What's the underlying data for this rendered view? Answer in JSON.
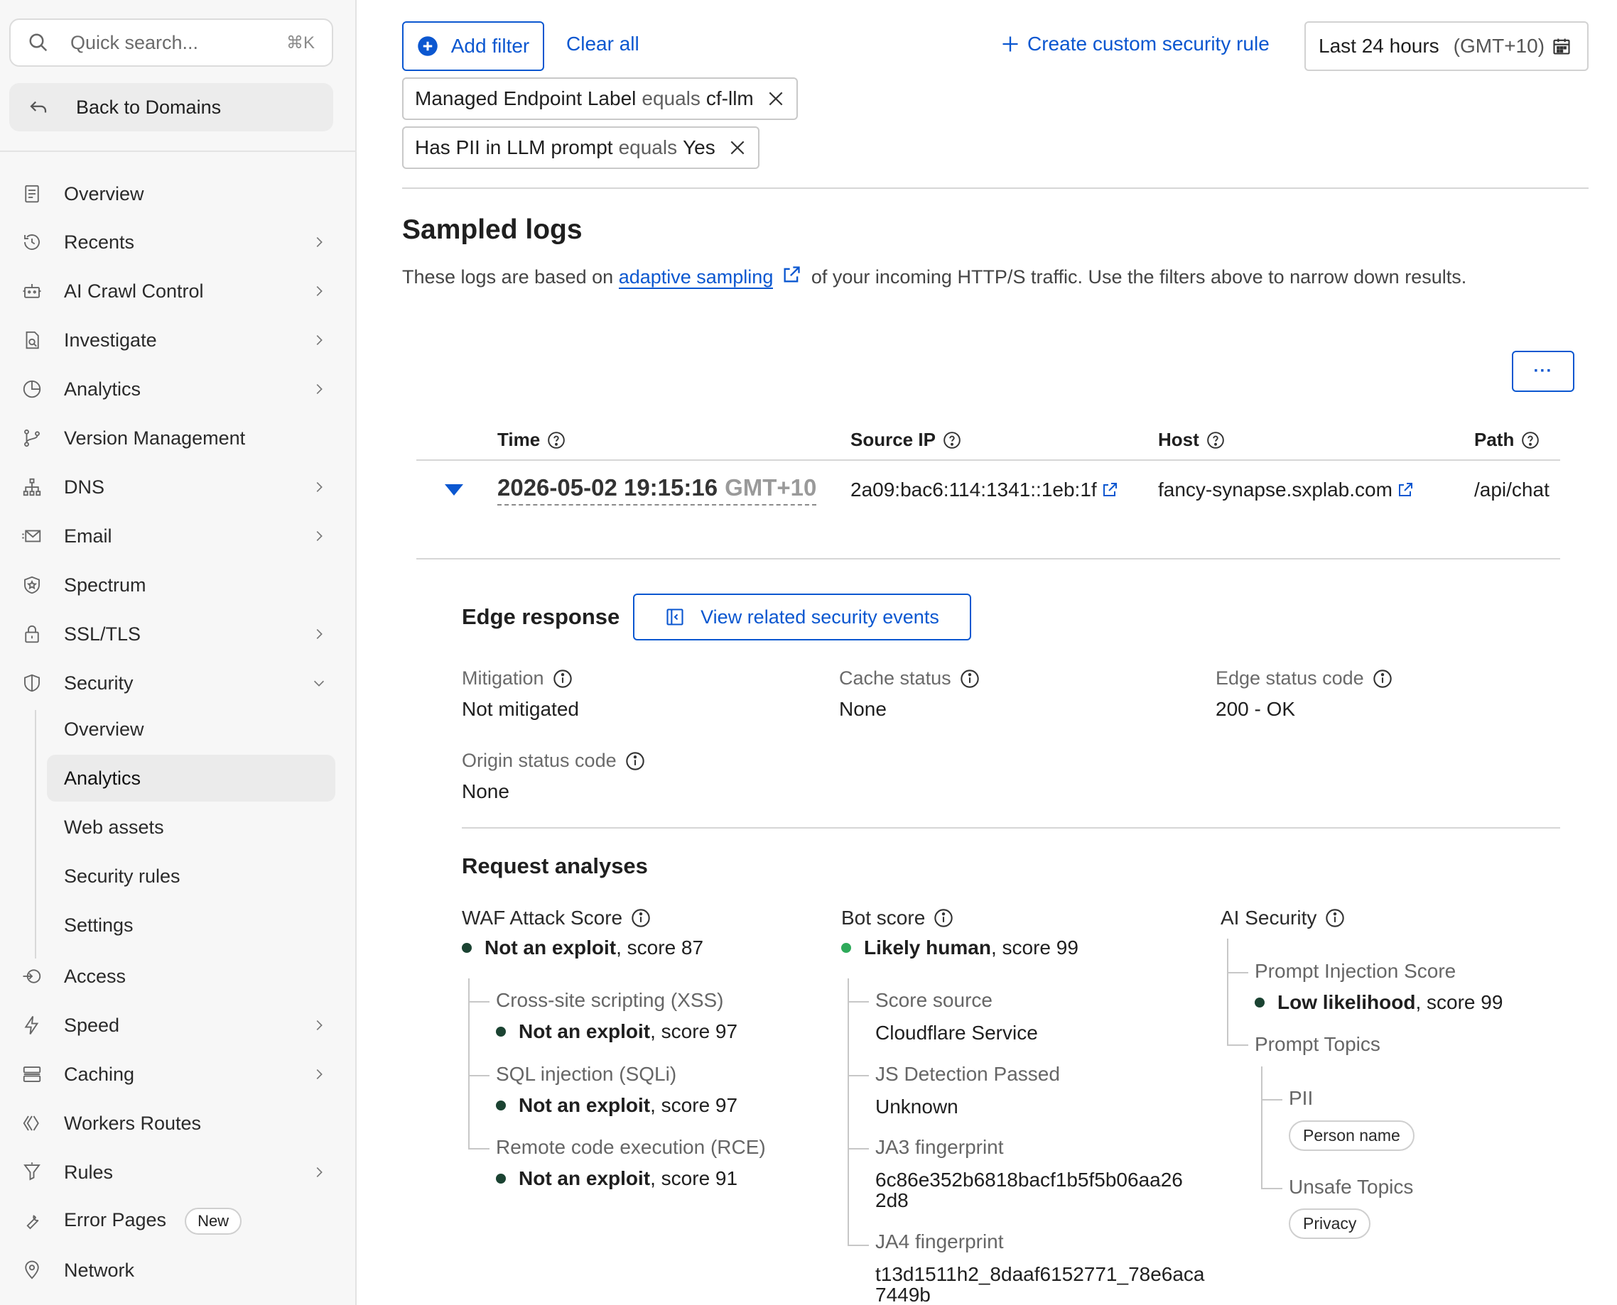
{
  "sidebar": {
    "search_placeholder": "Quick search...",
    "search_shortcut": "⌘K",
    "back_label": "Back to Domains",
    "items": [
      {
        "label": "Overview",
        "icon": "document-icon",
        "chevron": false
      },
      {
        "label": "Recents",
        "icon": "history-icon",
        "chevron": true
      },
      {
        "label": "AI Crawl Control",
        "icon": "robot-icon",
        "chevron": true
      },
      {
        "label": "Investigate",
        "icon": "investigate-icon",
        "chevron": true
      },
      {
        "label": "Analytics",
        "icon": "pie-chart-icon",
        "chevron": true
      },
      {
        "label": "Version Management",
        "icon": "branch-icon",
        "chevron": false
      },
      {
        "label": "DNS",
        "icon": "network-tree-icon",
        "chevron": true
      },
      {
        "label": "Email",
        "icon": "envelope-icon",
        "chevron": true
      },
      {
        "label": "Spectrum",
        "icon": "shield-star-icon",
        "chevron": false
      },
      {
        "label": "SSL/TLS",
        "icon": "lock-icon",
        "chevron": true
      },
      {
        "label": "Security",
        "icon": "shield-icon",
        "chevron": true,
        "expanded": true
      }
    ],
    "security_sub": [
      {
        "label": "Overview",
        "active": false
      },
      {
        "label": "Analytics",
        "active": true
      },
      {
        "label": "Web assets",
        "active": false
      },
      {
        "label": "Security rules",
        "active": false
      },
      {
        "label": "Settings",
        "active": false
      }
    ],
    "items_after": [
      {
        "label": "Access",
        "icon": "access-icon",
        "chevron": false
      },
      {
        "label": "Speed",
        "icon": "lightning-icon",
        "chevron": true
      },
      {
        "label": "Caching",
        "icon": "storage-icon",
        "chevron": true
      },
      {
        "label": "Workers Routes",
        "icon": "workers-icon",
        "chevron": false
      },
      {
        "label": "Rules",
        "icon": "funnel-icon",
        "chevron": true
      },
      {
        "label": "Error Pages",
        "icon": "wrench-icon",
        "chevron": false,
        "badge": "New"
      },
      {
        "label": "Network",
        "icon": "location-pin-icon",
        "chevron": false
      }
    ]
  },
  "filters": {
    "add_filter": "Add filter",
    "clear_all": "Clear all",
    "create_rule": "Create custom security rule",
    "time_range": "Last 24 hours",
    "timezone": "(GMT+10)",
    "chips": [
      {
        "field": "Managed Endpoint Label",
        "op": "equals",
        "value": "cf-llm"
      },
      {
        "field": "Has PII in LLM prompt",
        "op": "equals",
        "value": "Yes"
      }
    ]
  },
  "logs": {
    "title": "Sampled logs",
    "desc_before": "These logs are based on ",
    "desc_link": "adaptive sampling",
    "desc_after": " of your incoming HTTP/S traffic. Use the filters above to narrow down results.",
    "more_button": "···",
    "columns": [
      "Time",
      "Source IP",
      "Host",
      "Path"
    ],
    "row": {
      "time": "2026-05-02 19:15:16",
      "tz": "GMT+10",
      "source_ip": "2a09:bac6:114:1341::1eb:1f",
      "host": "fancy-synapse.sxplab.com",
      "path": "/api/chat"
    }
  },
  "edge": {
    "title": "Edge response",
    "view_events": "View related security events",
    "fields": [
      {
        "label": "Mitigation",
        "value": "Not mitigated"
      },
      {
        "label": "Cache status",
        "value": "None"
      },
      {
        "label": "Edge status code",
        "value": "200 - OK"
      },
      {
        "label": "Origin status code",
        "value": "None"
      }
    ]
  },
  "analyses": {
    "title": "Request analyses",
    "waf": {
      "label": "WAF Attack Score",
      "verdict": "Not an exploit",
      "score": ", score 87",
      "subs": [
        {
          "label": "Cross-site scripting (XSS)",
          "verdict": "Not an exploit",
          "score": ", score 97"
        },
        {
          "label": "SQL injection (SQLi)",
          "verdict": "Not an exploit",
          "score": ", score 97"
        },
        {
          "label": "Remote code execution (RCE)",
          "verdict": "Not an exploit",
          "score": ", score 91"
        }
      ]
    },
    "bot": {
      "label": "Bot score",
      "verdict": "Likely human",
      "score": ", score 99",
      "subs": [
        {
          "label": "Score source",
          "value": "Cloudflare Service"
        },
        {
          "label": "JS Detection Passed",
          "value": "Unknown"
        },
        {
          "label": "JA3 fingerprint",
          "value1": "6c86e352b6818bacf1b5f5b06aa26",
          "value2": "2d8"
        },
        {
          "label": "JA4 fingerprint",
          "value1": "t13d1511h2_8daaf6152771_78e6aca",
          "value2": "7449b"
        }
      ]
    },
    "ai": {
      "label": "AI Security",
      "prompt_injection_label": "Prompt Injection Score",
      "prompt_injection_verdict": "Low likelihood",
      "prompt_injection_score": ", score 99",
      "prompt_topics_label": "Prompt Topics",
      "pii_label": "PII",
      "pii_tag": "Person name",
      "unsafe_label": "Unsafe Topics",
      "unsafe_tag": "Privacy"
    }
  },
  "colors": {
    "accent": "#0b57d0",
    "dot_dark": "#1b4332",
    "dot_green": "#2eaa5a"
  }
}
